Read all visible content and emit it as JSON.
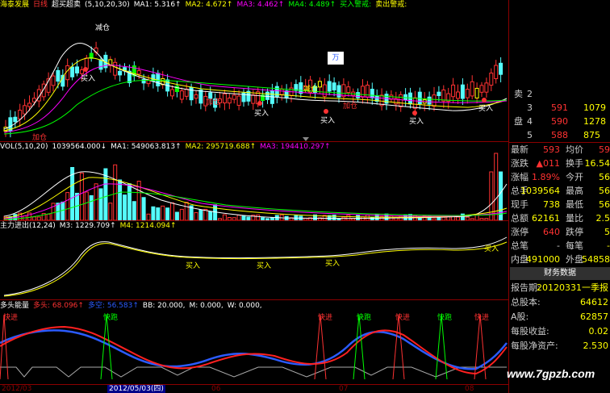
{
  "colors": {
    "up": "#ff3232",
    "down": "#54fcfc",
    "yellow": "#ffff00",
    "white": "#ffffff",
    "magenta": "#ff00ff",
    "green": "#00ff00",
    "blue": "#2b5bff",
    "red": "#ff2020",
    "axis": "#8b0000"
  },
  "price_header": {
    "name": "海泰发展",
    "period": "日线",
    "indicator": "超买超卖",
    "params": "(5,10,20,30)",
    "ma1": "MA1: 5.316↑",
    "ma2": "MA2: 4.672↑",
    "ma3": "MA3: 4.462↑",
    "ma4": "MA4: 4.489↑",
    "buy_warn": "买入警戒:",
    "sell_warn": "卖出警戒:"
  },
  "price_annotations": {
    "reduce": "减仓",
    "add": "加仓",
    "buy": "买入",
    "logo": "万"
  },
  "vol_header": {
    "label": "VOL(5,10,20)",
    "vol": "1039564.000↓",
    "ma1": "MA1: 549063.813↑",
    "ma2": "MA2: 295719.688↑",
    "ma3": "MA3: 194410.297↑"
  },
  "zl_header": {
    "label": "主力进出(12,24)",
    "m3": "M3: 1229.709↑",
    "m4": "M4: 1214.094↑"
  },
  "zl_annotations": {
    "buy": "买入"
  },
  "dk_header": {
    "label": "多头能量",
    "duo": "多头: 68.096↑",
    "kong": "多空: 56.583↑",
    "bb": "BB: 20.000,",
    "m": "M: 0.000,",
    "w": "W: 0.000,"
  },
  "dk_annotations": {
    "enter": "快进",
    "run": "快跑"
  },
  "date_axis": {
    "start": "2012/03",
    "cursor": "2012/05/03(四)",
    "m06": "06",
    "m07": "07",
    "m08": "08"
  },
  "order_book": [
    {
      "label": "卖",
      "idx": "2",
      "price": "",
      "vol": ""
    },
    {
      "label": "",
      "idx": "3",
      "price": "591",
      "vol": "1079"
    },
    {
      "label": "盘",
      "idx": "4",
      "price": "590",
      "vol": "1278"
    },
    {
      "label": "",
      "idx": "5",
      "price": "588",
      "vol": "875"
    }
  ],
  "quote": [
    {
      "l1": "最新",
      "v1": "593",
      "l2": "均价",
      "v2": "59"
    },
    {
      "l1": "涨跌",
      "v1": "▲011",
      "l2": "换手",
      "v2": "16.54"
    },
    {
      "l1": "涨幅",
      "v1": "1.89%",
      "l2": "今开",
      "v2": "56"
    },
    {
      "l1": "总手",
      "v1": "1039564",
      "l2": "最高",
      "v2": "56"
    },
    {
      "l1": "现手",
      "v1": "738",
      "l2": "最低",
      "v2": "56"
    },
    {
      "l1": "总额",
      "v1": "62161",
      "l2": "量比",
      "v2": "2.5"
    },
    {
      "l1": "涨停",
      "v1": "640",
      "l2": "跌停",
      "v2": "5"
    },
    {
      "l1": "总笔",
      "v1": "-",
      "l2": "每笔",
      "v2": "-"
    },
    {
      "l1": "内盘",
      "v1": "491000",
      "l2": "外盘",
      "v2": "54858"
    }
  ],
  "fin_tab": "财务数据",
  "fin": [
    {
      "l": "报告期:",
      "v": "20120331一季报"
    },
    {
      "l": "总股本:",
      "v": "64612"
    },
    {
      "l": "A股:",
      "v": "62857"
    },
    {
      "l": "每股收益:",
      "v": "0.02"
    },
    {
      "l": "每股净资产:",
      "v": "2.530"
    },
    {
      "l": "",
      "v": ""
    }
  ],
  "watermark": "www.7gpzb.com"
}
